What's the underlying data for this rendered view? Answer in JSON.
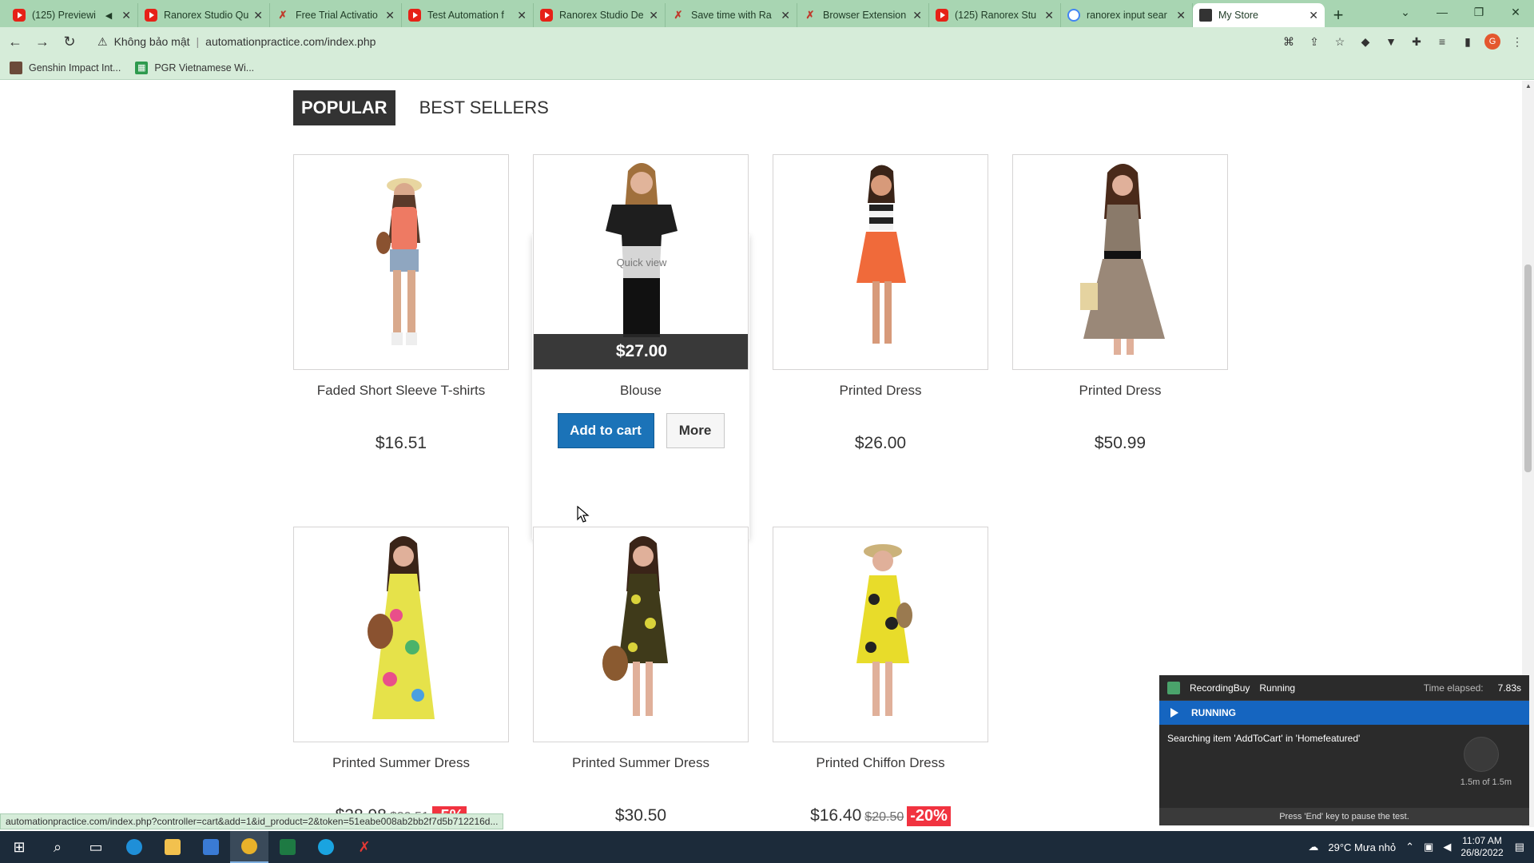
{
  "browser": {
    "tabs": [
      {
        "icon": "youtube-icon",
        "label": "(125) Previewi",
        "muted": true
      },
      {
        "icon": "youtube-icon",
        "label": "Ranorex Studio Qu"
      },
      {
        "icon": "ranorex-icon",
        "label": "Free Trial Activatio"
      },
      {
        "icon": "youtube-icon",
        "label": "Test Automation f"
      },
      {
        "icon": "youtube-icon",
        "label": "Ranorex Studio De"
      },
      {
        "icon": "ranorex-icon",
        "label": "Save time with Ra"
      },
      {
        "icon": "ranorex-icon",
        "label": "Browser Extension"
      },
      {
        "icon": "youtube-icon",
        "label": "(125) Ranorex Stu"
      },
      {
        "icon": "google-icon",
        "label": "ranorex input sear"
      },
      {
        "icon": "store-icon",
        "label": "My Store",
        "active": true
      }
    ],
    "address": {
      "security": "Không bảo mật",
      "url": "automationpractice.com/index.php"
    },
    "bookmarks": [
      {
        "icon": "genshin-icon",
        "label": "Genshin Impact Int..."
      },
      {
        "icon": "sheets-icon",
        "label": "PGR Vietnamese Wi..."
      }
    ],
    "profile_initial": "G",
    "status_url": "automationpractice.com/index.php?controller=cart&add=1&id_product=2&token=51eabe008ab2bb2f7d5b712216d..."
  },
  "store": {
    "tabs": [
      {
        "label": "POPULAR",
        "active": true
      },
      {
        "label": "BEST SELLERS",
        "active": false
      }
    ],
    "products": [
      {
        "name": "Faded Short Sleeve T-shirts",
        "price": "$16.51"
      },
      {
        "name": "Blouse",
        "price": "$27.00",
        "hover": true
      },
      {
        "name": "Printed Dress",
        "price": "$26.00"
      },
      {
        "name": "Printed Dress",
        "price": "$50.99"
      },
      {
        "name": "Printed Summer Dress",
        "price": "$28.98",
        "old_price": "$30.51",
        "discount": "-5%"
      },
      {
        "name": "Printed Summer Dress",
        "price": "$30.50"
      },
      {
        "name": "Printed Chiffon Dress",
        "price": "$16.40",
        "old_price": "$20.50",
        "discount": "-20%"
      }
    ],
    "quick_view": "Quick view",
    "add_to_cart": "Add to cart",
    "more": "More"
  },
  "ranorex": {
    "test_name": "RecordingBuy",
    "status": "Running",
    "elapsed_label": "Time elapsed:",
    "elapsed": "7.83s",
    "state": "RUNNING",
    "message": "Searching item 'AddToCart' in 'Homefeatured'",
    "progress": "1.5m of 1.5m",
    "footer": "Press 'End' key to pause the test."
  },
  "taskbar": {
    "weather": "29°C  Mưa nhỏ",
    "time": "11:07 AM",
    "date": "26/8/2022"
  },
  "colors": {
    "chrome_green": "#a8d5b2",
    "cart_blue": "#1b73b8",
    "discount_red": "#f13340",
    "ranorex_blue": "#1565c0"
  }
}
